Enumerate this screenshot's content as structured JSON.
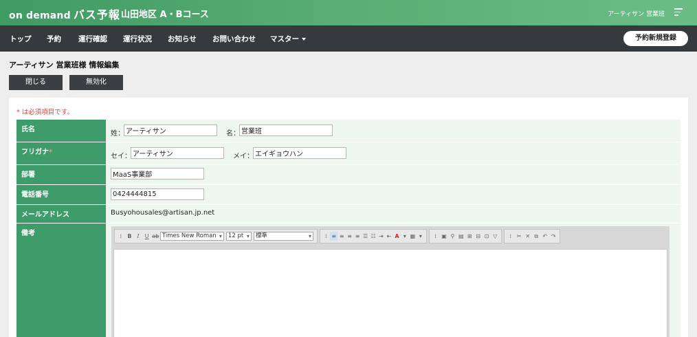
{
  "header": {
    "logo_on": "on demand",
    "logo_jp": "バス予報",
    "route_title": "山田地区 A・Bコース",
    "user_name": "アーティサン 営業班"
  },
  "nav": {
    "items": [
      "トップ",
      "予約",
      "運行確認",
      "運行状況",
      "お知らせ",
      "お問い合わせ",
      "マスター"
    ],
    "new_booking": "予約新規登録"
  },
  "page": {
    "title": "アーティサン 営業班様 情報編集",
    "close_label": "閉じる",
    "disable_label": "無効化",
    "required_note": "* は必須項目です。"
  },
  "form": {
    "name_label": "氏名",
    "last_name_label": "姓：",
    "last_name_value": "アーティサン",
    "first_name_label": "名：",
    "first_name_value": "営業班",
    "kana_label": "フリガナ",
    "kana_required": "*",
    "last_kana_label": "セイ：",
    "last_kana_value": "アーティサン",
    "first_kana_label": "メイ：",
    "first_kana_value": "エイギョウハン",
    "dept_label": "部署",
    "dept_value": "MaaS事業部",
    "phone_label": "電話番号",
    "phone_value": "0424444815",
    "email_label": "メールアドレス",
    "email_value": "Busyohousales@artisan.jp.net",
    "notes_label": "備考"
  },
  "editor": {
    "font_family": "Times New Roman",
    "font_size": "12 pt",
    "paragraph_style": "標準"
  },
  "colors": {
    "header_green": "#4fa56d",
    "nav_dark": "#373a3c",
    "label_green": "#3d9c6a",
    "value_bg": "#edf7ef",
    "required_red": "#e0473f"
  }
}
